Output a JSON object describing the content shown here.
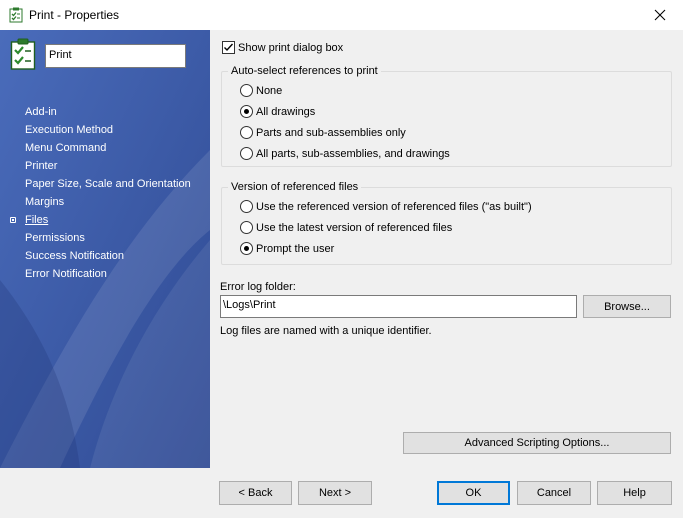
{
  "window": {
    "title": "Print - Properties",
    "app_icon": "checklist-icon",
    "close_icon": "close-icon"
  },
  "sidebar": {
    "icon": "checklist-icon",
    "name_value": "Print",
    "items": [
      {
        "label": "Add-in"
      },
      {
        "label": "Execution Method"
      },
      {
        "label": "Menu Command"
      },
      {
        "label": "Printer"
      },
      {
        "label": "Paper Size, Scale and Orientation"
      },
      {
        "label": "Margins"
      },
      {
        "label": "Files",
        "active": true
      },
      {
        "label": "Permissions"
      },
      {
        "label": "Success Notification"
      },
      {
        "label": "Error Notification"
      }
    ]
  },
  "main": {
    "show_dialog": {
      "label": "Show print dialog box",
      "checked": true
    },
    "auto_select": {
      "legend": "Auto-select references to print",
      "options": [
        {
          "label": "None",
          "selected": false
        },
        {
          "label": "All drawings",
          "selected": true
        },
        {
          "label": "Parts and sub-assemblies only",
          "selected": false
        },
        {
          "label": "All parts, sub-assemblies, and drawings",
          "selected": false
        }
      ]
    },
    "version": {
      "legend": "Version of referenced files",
      "options": [
        {
          "label": "Use the referenced version of referenced files (\"as built\")",
          "selected": false
        },
        {
          "label": "Use the latest version of referenced files",
          "selected": false
        },
        {
          "label": "Prompt the user",
          "selected": true
        }
      ]
    },
    "error_log": {
      "label": "Error log folder:",
      "value": "\\Logs\\Print",
      "browse_label": "Browse...",
      "note": "Log files are named with a unique identifier."
    },
    "advanced_label": "Advanced Scripting Options..."
  },
  "footer": {
    "back_label": "< Back",
    "next_label": "Next >",
    "ok_label": "OK",
    "cancel_label": "Cancel",
    "help_label": "Help"
  },
  "colors": {
    "sidebar_blue": "#3c5aa6",
    "panel_bg": "#f0f0f0",
    "default_button_border": "#0078d7"
  }
}
